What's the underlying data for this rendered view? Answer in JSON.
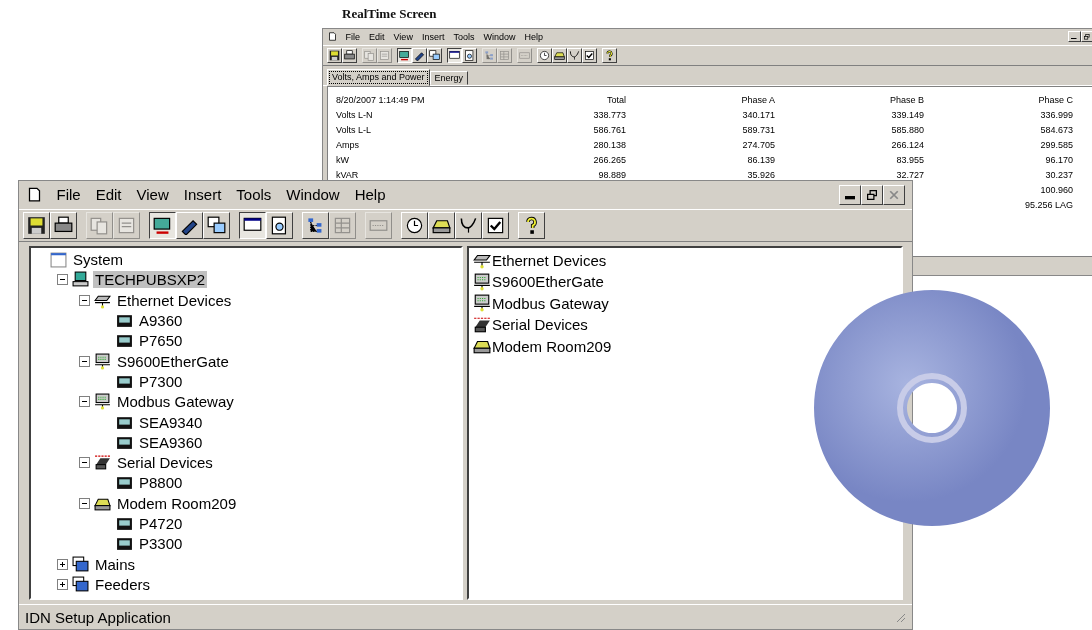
{
  "caption": "RealTime Screen",
  "back_window": {
    "menu": [
      "File",
      "Edit",
      "View",
      "Insert",
      "Tools",
      "Window",
      "Help"
    ],
    "toolbar": [
      [
        {
          "kind": "save",
          "disabled": false,
          "pressed": false
        },
        {
          "kind": "print",
          "disabled": false,
          "pressed": false
        }
      ],
      [
        {
          "kind": "copy",
          "disabled": true,
          "pressed": false
        },
        {
          "kind": "props",
          "disabled": true,
          "pressed": false
        }
      ],
      [
        {
          "kind": "network",
          "disabled": false,
          "pressed": true
        },
        {
          "kind": "link",
          "disabled": false,
          "pressed": false
        },
        {
          "kind": "windows",
          "disabled": false,
          "pressed": false
        }
      ],
      [
        {
          "kind": "monitor",
          "disabled": false,
          "pressed": true
        },
        {
          "kind": "preview",
          "disabled": false,
          "pressed": false
        }
      ],
      [
        {
          "kind": "tree",
          "disabled": true,
          "pressed": false
        },
        {
          "kind": "grid",
          "disabled": true,
          "pressed": false
        }
      ],
      [
        {
          "kind": "meter",
          "disabled": true,
          "pressed": false
        }
      ],
      [
        {
          "kind": "clock",
          "disabled": false,
          "pressed": false
        },
        {
          "kind": "modem",
          "disabled": false,
          "pressed": false
        },
        {
          "kind": "stethoscope",
          "disabled": false,
          "pressed": false
        },
        {
          "kind": "check",
          "disabled": false,
          "pressed": false
        }
      ],
      [
        {
          "kind": "help",
          "disabled": false,
          "pressed": false
        }
      ]
    ],
    "tabs": [
      {
        "label": "Volts, Amps and Power",
        "selected": true
      },
      {
        "label": "Energy",
        "selected": false
      }
    ],
    "table": {
      "columns": [
        "8/20/2007 1:14:49 PM",
        "Total",
        "Phase A",
        "Phase B",
        "Phase C"
      ],
      "rows": [
        {
          "label": "Volts L-N",
          "total": "338.773",
          "phase_a": "340.171",
          "phase_b": "339.149",
          "phase_c": "336.999"
        },
        {
          "label": "Volts L-L",
          "total": "586.761",
          "phase_a": "589.731",
          "phase_b": "585.880",
          "phase_c": "584.673"
        },
        {
          "label": "Amps",
          "total": "280.138",
          "phase_a": "274.705",
          "phase_b": "266.124",
          "phase_c": "299.585"
        },
        {
          "label": "kW",
          "total": "266.265",
          "phase_a": "86.139",
          "phase_b": "83.955",
          "phase_c": "96.170"
        },
        {
          "label": "kVAR",
          "total": "98.889",
          "phase_a": "35.926",
          "phase_b": "32.727",
          "phase_c": "30.237"
        },
        {
          "phase_c": "100.960"
        },
        {
          "phase_c": "95.256 LAG"
        }
      ]
    }
  },
  "front_window": {
    "menu": [
      "File",
      "Edit",
      "View",
      "Insert",
      "Tools",
      "Window",
      "Help"
    ],
    "toolbar": [
      [
        {
          "kind": "save",
          "disabled": false,
          "pressed": false
        },
        {
          "kind": "print",
          "disabled": false,
          "pressed": false
        }
      ],
      [
        {
          "kind": "copy",
          "disabled": true,
          "pressed": false
        },
        {
          "kind": "props",
          "disabled": true,
          "pressed": false
        }
      ],
      [
        {
          "kind": "network",
          "disabled": false,
          "pressed": true
        },
        {
          "kind": "link",
          "disabled": false,
          "pressed": false
        },
        {
          "kind": "windows",
          "disabled": false,
          "pressed": false
        }
      ],
      [
        {
          "kind": "monitor",
          "disabled": false,
          "pressed": true
        },
        {
          "kind": "preview",
          "disabled": false,
          "pressed": false
        }
      ],
      [
        {
          "kind": "tree",
          "disabled": false,
          "pressed": false
        },
        {
          "kind": "grid",
          "disabled": true,
          "pressed": false
        }
      ],
      [
        {
          "kind": "meter",
          "disabled": true,
          "pressed": false
        }
      ],
      [
        {
          "kind": "clock",
          "disabled": false,
          "pressed": false
        },
        {
          "kind": "modem",
          "disabled": false,
          "pressed": false
        },
        {
          "kind": "stethoscope",
          "disabled": false,
          "pressed": false
        },
        {
          "kind": "check",
          "disabled": false,
          "pressed": false
        }
      ],
      [
        {
          "kind": "help",
          "disabled": false,
          "pressed": false
        }
      ]
    ],
    "tree": [
      {
        "label": "System",
        "kind": "system",
        "selected": false,
        "children": [
          {
            "label": "TECHPUBSXP2",
            "kind": "computer",
            "selected": true,
            "expanded": true,
            "children": [
              {
                "label": "Ethernet Devices",
                "kind": "ethernet",
                "selected": false,
                "expanded": true,
                "children": [
                  {
                    "label": "A9360",
                    "kind": "device",
                    "selected": false
                  },
                  {
                    "label": "P7650",
                    "kind": "device",
                    "selected": false
                  }
                ]
              },
              {
                "label": "S9600EtherGate",
                "kind": "gateway",
                "selected": false,
                "expanded": true,
                "children": [
                  {
                    "label": "P7300",
                    "kind": "device",
                    "selected": false
                  }
                ]
              },
              {
                "label": "Modbus Gateway",
                "kind": "gateway",
                "selected": false,
                "expanded": true,
                "children": [
                  {
                    "label": "SEA9340",
                    "kind": "device",
                    "selected": false
                  },
                  {
                    "label": "SEA9360",
                    "kind": "device",
                    "selected": false
                  }
                ]
              },
              {
                "label": "Serial Devices",
                "kind": "serial",
                "selected": false,
                "expanded": true,
                "children": [
                  {
                    "label": "P8800",
                    "kind": "device",
                    "selected": false
                  }
                ]
              },
              {
                "label": "Modem Room209",
                "kind": "modem",
                "selected": false,
                "expanded": true,
                "children": [
                  {
                    "label": "P4720",
                    "kind": "device",
                    "selected": false
                  },
                  {
                    "label": "P3300",
                    "kind": "device",
                    "selected": false
                  }
                ]
              }
            ]
          },
          {
            "label": "Mains",
            "kind": "group",
            "selected": false,
            "expanded": false
          },
          {
            "label": "Feeders",
            "kind": "group",
            "selected": false,
            "expanded": false
          }
        ]
      }
    ],
    "list": [
      {
        "label": "Ethernet Devices",
        "kind": "ethernet"
      },
      {
        "label": "S9600EtherGate",
        "kind": "gateway"
      },
      {
        "label": "Modbus Gateway",
        "kind": "gateway"
      },
      {
        "label": "Serial Devices",
        "kind": "serial"
      },
      {
        "label": "Modem Room209",
        "kind": "modem"
      }
    ],
    "status_bar": "IDN Setup Application"
  }
}
